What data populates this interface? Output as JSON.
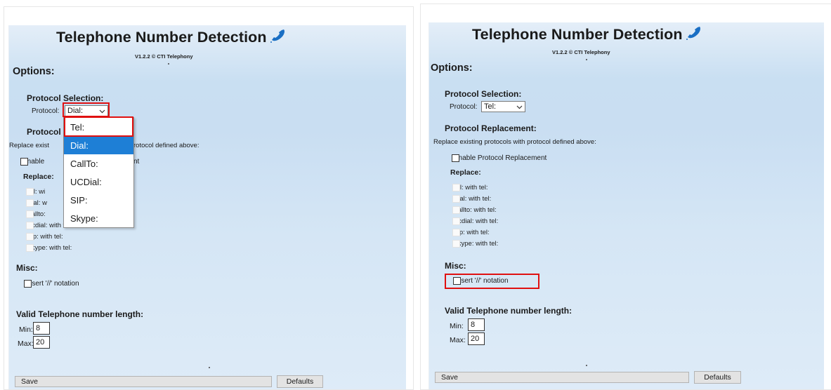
{
  "left": {
    "title": "Telephone Number Detection",
    "version": "V1.2.2 © CTI Telephony",
    "options_heading": "Options:",
    "protocol_selection_heading": "Protocol Selection:",
    "protocol_label": "Protocol:",
    "protocol_value": "Dial:",
    "dropdown_options": [
      "Tel:",
      "Dial:",
      "CallTo:",
      "UCDial:",
      "SIP:",
      "Skype:"
    ],
    "dropdown_selected": "Dial:",
    "protocol_replacement_heading_partial": "Protocol",
    "replace_desc_left": "Replace exist",
    "replace_desc_right": "rotocol defined above:",
    "enable_left": "Enable",
    "enable_right": "nt",
    "replace_heading": "Replace:",
    "replace_partial": [
      "tel: wi",
      "dial: w",
      "callto:",
      "ucdial: with tel:",
      "sip: with tel:",
      "skype: with tel:"
    ],
    "misc_heading": "Misc:",
    "insert_notation": "Insert '//' notation",
    "valid_length_heading": "Valid Telephone number length:",
    "min_label": "Min:",
    "min_value": "8",
    "max_label": "Max:",
    "max_value": "20",
    "save_label": "Save",
    "defaults_label": "Defaults"
  },
  "right": {
    "title": "Telephone Number Detection",
    "version": "V1.2.2 © CTI Telephony",
    "options_heading": "Options:",
    "protocol_selection_heading": "Protocol Selection:",
    "protocol_label": "Protocol:",
    "protocol_value": "Tel:",
    "protocol_replacement_heading": "Protocol Replacement:",
    "replace_desc": "Replace existing protocols with protocol defined above:",
    "enable_label": "Enable Protocol Replacement",
    "replace_heading": "Replace:",
    "replace_items": [
      "tel: with tel:",
      "dial: with tel:",
      "callto: with tel:",
      "ucdial: with tel:",
      "sip: with tel:",
      "skype: with tel:"
    ],
    "misc_heading": "Misc:",
    "insert_notation": "Insert '//' notation",
    "valid_length_heading": "Valid Telephone number length:",
    "min_label": "Min:",
    "min_value": "8",
    "max_label": "Max:",
    "max_value": "20",
    "save_label": "Save",
    "defaults_label": "Defaults"
  },
  "colors": {
    "highlight": "#e01010",
    "selected_option": "#1e7fd6",
    "panel_gradient_top": "#e4eef8",
    "panel_gradient_mid": "#c9dff2"
  },
  "icons": [
    "phone-handset-icon",
    "chevron-down-icon"
  ]
}
